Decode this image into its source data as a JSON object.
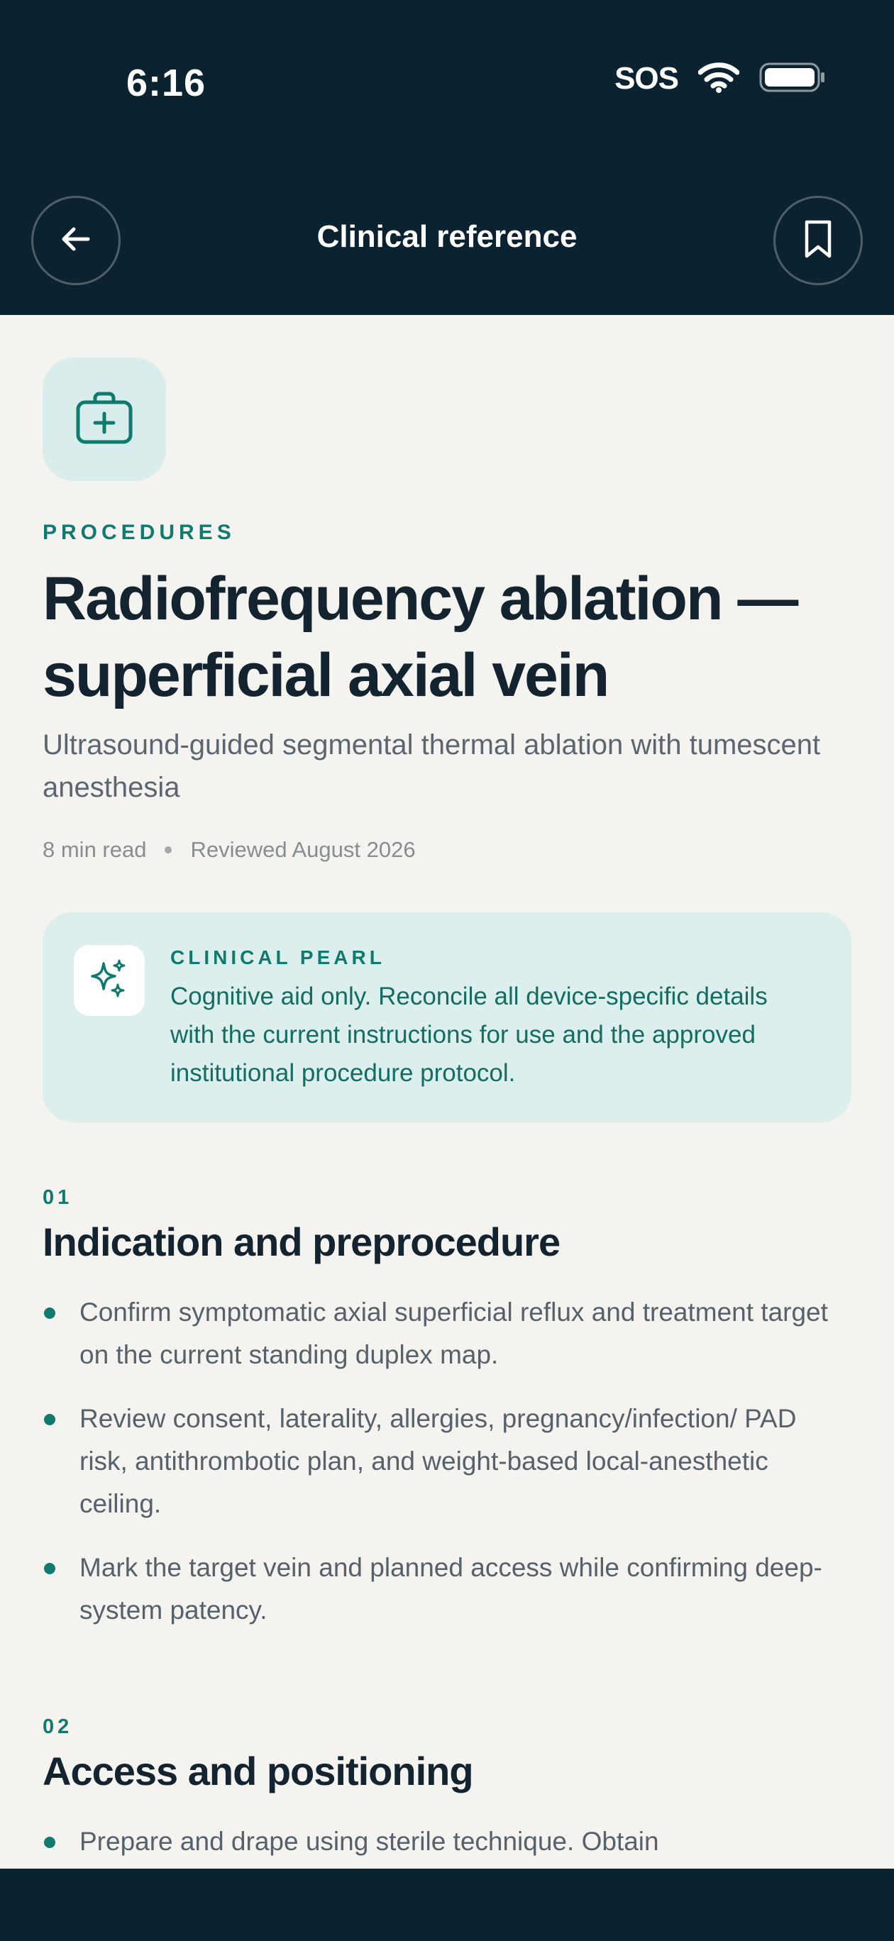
{
  "status_bar": {
    "time": "6:16",
    "sos": "SOS"
  },
  "nav": {
    "title": "Clinical reference"
  },
  "article": {
    "category": "PROCEDURES",
    "title": "Radiofrequency ablation — superficial axial vein",
    "subtitle": "Ultrasound-guided segmental thermal ablation with tumescent anesthesia",
    "read_time": "8 min read",
    "reviewed": "Reviewed August 2026"
  },
  "pearl": {
    "label": "CLINICAL PEARL",
    "text": "Cognitive aid only. Reconcile all device-specific details with the current instructions for use and the approved institutional procedure protocol."
  },
  "sections": [
    {
      "number": "01",
      "title": "Indication and preprocedure",
      "items": [
        "Confirm symptomatic axial superficial reflux and treatment target on the current standing duplex map.",
        "Review consent, laterality, allergies, pregnancy/infection/ PAD risk, antithrombotic plan, and weight-based local-anesthetic ceiling.",
        "Mark the target vein and planned access while confirming deep-system patency."
      ]
    },
    {
      "number": "02",
      "title": "Access and positioning",
      "items": [
        "Prepare and drape using sterile technique. Obtain"
      ]
    }
  ],
  "colors": {
    "header_bg": "#0b2230",
    "accent": "#0f7a6e",
    "page_bg": "#f5f3ef",
    "pearl_bg": "#dcefec"
  },
  "icons": {
    "back": "arrow-left-icon",
    "bookmark": "bookmark-icon",
    "category": "medical-kit-icon",
    "pearl": "sparkles-icon",
    "wifi": "wifi-icon",
    "battery": "battery-icon"
  }
}
